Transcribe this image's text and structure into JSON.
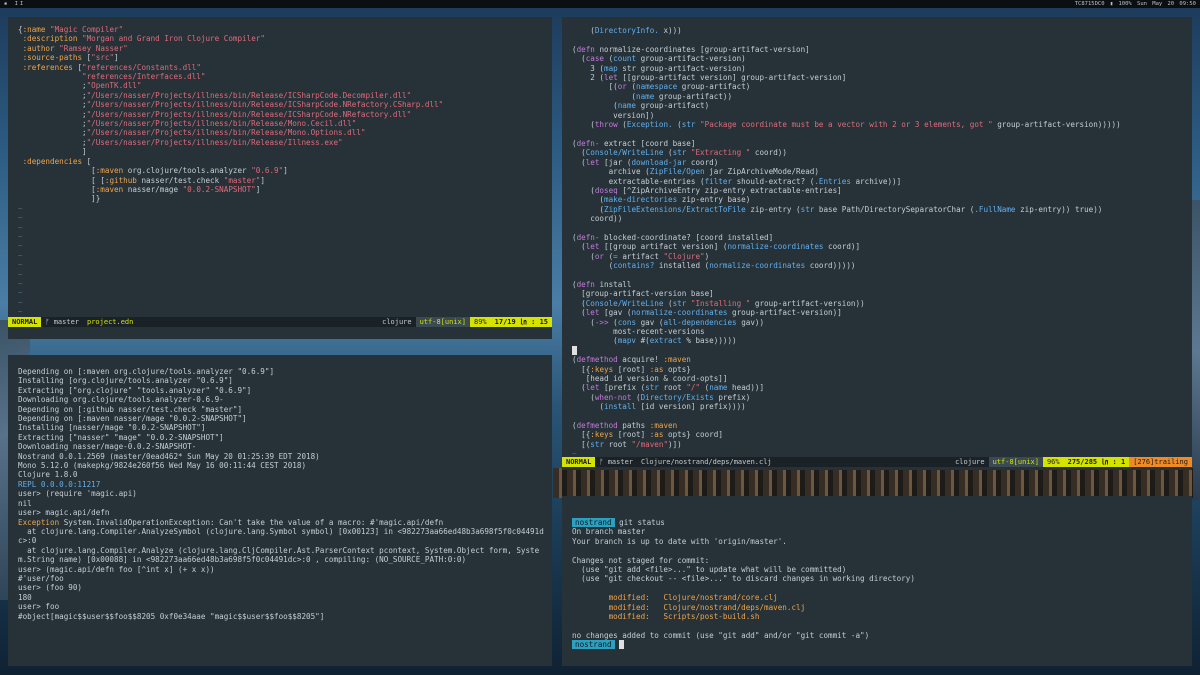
{
  "topbar": {
    "workspaces": "▪ II",
    "tray": "TC8715DC0  ▮ 100%  Sun May 20 09:50"
  },
  "vim_left": {
    "lines": [
      "{:name \"Magic Compiler\"",
      " :description \"Morgan and Grand Iron Clojure Compiler\"",
      " :author \"Ramsey Nasser\"",
      " :source-paths [\"src\"]",
      " :references [\"references/Constants.dll\"",
      "              \"references/Interfaces.dll\"",
      "              ;\"OpenTK.dll\"",
      "              ;\"/Users/nasser/Projects/illness/bin/Release/ICSharpCode.Decompiler.dll\"",
      "              ;\"/Users/nasser/Projects/illness/bin/Release/ICSharpCode.NRefactory.CSharp.dll\"",
      "              ;\"/Users/nasser/Projects/illness/bin/Release/ICSharpCode.NRefactory.dll\"",
      "              ;\"/Users/nasser/Projects/illness/bin/Release/Mono.Cecil.dll\"",
      "              ;\"/Users/nasser/Projects/illness/bin/Release/Mono.Options.dll\"",
      "              ;\"/Users/nasser/Projects/illness/bin/Release/Illness.exe\"",
      "              ]",
      " :dependencies [",
      "                [:maven org.clojure/tools.analyzer \"0.6.9\"]",
      "                [ [:github nasser/test.check \"master\"]",
      "                [:maven nasser/mage \"0.0.2-SNAPSHOT\"]",
      "                ]}"
    ],
    "tildes": 12,
    "status": {
      "mode": "NORMAL",
      "branch": "ᚠ master",
      "file": "project.edn",
      "filetype": "clojure",
      "encoding": "utf-8[unix]",
      "percent": "89%",
      "position": "17/19 ㏑ : 15"
    }
  },
  "repl": {
    "lines": [
      "Depending on [:maven org.clojure/tools.analyzer \"0.6.9\"]",
      "Installing [org.clojure/tools.analyzer \"0.6.9\"]",
      "Extracting [\"org.clojure\" \"tools.analyzer\" \"0.6.9\"]",
      "Downloading org.clojure/tools.analyzer-0.6.9-",
      "Depending on [:github nasser/test.check \"master\"]",
      "Depending on [:maven nasser/mage \"0.0.2-SNAPSHOT\"]",
      "Installing [nasser/mage \"0.0.2-SNAPSHOT\"]",
      "Extracting [\"nasser\" \"mage\" \"0.0.2-SNAPSHOT\"]",
      "Downloading nasser/mage-0.0.2-SNAPSHOT-",
      "Nostrand 0.0.1.2569 (master/0ead462* Sun May 20 01:25:39 EDT 2018)",
      "Mono 5.12.0 (makepkg/9824e260f56 Wed May 16 00:11:44 CEST 2018)",
      "Clojure 1.8.0",
      "REPL 0.0.0.0:11217",
      "user> (require 'magic.api)",
      "nil",
      "user> magic.api/defn",
      "Exception System.InvalidOperationException: Can't take the value of a macro: #'magic.api/defn",
      "  at clojure.lang.Compiler.AnalyzeSymbol (clojure.lang.Symbol symbol) [0x00123] in <982273aa66ed48b3a698f5f0c04491dc>:0",
      "  at clojure.lang.Compiler.Analyze (clojure.lang.CljCompiler.Ast.ParserContext pcontext, System.Object form, System.String name) [0x00088] in <982273aa66ed48b3a698f5f0c04491dc>:0 , compiling: (NO_SOURCE_PATH:0:0)",
      "user> (magic.api/defn foo [^int x] (+ x x))",
      "#'user/foo",
      "user> (foo 90)",
      "180",
      "user> foo",
      "#object[magic$$user$$foo$$8205 0xf0e34aae \"magic$$user$$foo$$8205\"]"
    ]
  },
  "vim_right": {
    "lines": [
      "    (DirectoryInfo. x)))",
      "",
      "(defn normalize-coordinates [group-artifact-version]",
      "  (case (count group-artifact-version)",
      "    3 (map str group-artifact-version)",
      "    2 (let [[group-artifact version] group-artifact-version]",
      "        [(or (namespace group-artifact)",
      "             (name group-artifact))",
      "         (name group-artifact)",
      "         version])",
      "    (throw (Exception. (str \"Package coordinate must be a vector with 2 or 3 elements, got \" group-artifact-version)))))",
      "",
      "(defn- extract [coord base]",
      "  (Console/WriteLine (str \"Extracting \" coord))",
      "  (let [jar (download-jar coord)",
      "        archive (ZipFile/Open jar ZipArchiveMode/Read)",
      "        extractable-entries (filter should-extract? (.Entries archive))]",
      "    (doseq [^ZipArchiveEntry zip-entry extractable-entries]",
      "      (make-directories zip-entry base)",
      "      (ZipFileExtensions/ExtractToFile zip-entry (str base Path/DirectorySeparatorChar (.FullName zip-entry)) true))",
      "    coord))",
      "",
      "(defn- blocked-coordinate? [coord installed]",
      "  (let [[group artifact version] (normalize-coordinates coord)]",
      "    (or (= artifact \"Clojure\")",
      "        (contains? installed (normalize-coordinates coord)))))",
      "",
      "(defn install",
      "  [group-artifact-version base]",
      "  (Console/WriteLine (str \"Installing \" group-artifact-version))",
      "  (let [gav (normalize-coordinates group-artifact-version)]",
      "    (->> (cons gav (all-dependencies gav))",
      "         most-recent-versions",
      "         (mapv #(extract % base)))))",
      " ",
      "(defmethod acquire! :maven",
      "  [{:keys [root] :as opts}",
      "   [head id version & coord-opts]]",
      "  (let [prefix (str root \"/\" (name head))]",
      "    (when-not (Directory/Exists prefix)",
      "      (install [id version] prefix))))",
      "",
      "(defmethod paths :maven",
      "  [{:keys [root] :as opts} coord]",
      "  [(str root \"/maven\")])",
      "~"
    ],
    "status": {
      "mode": "NORMAL",
      "branch": "ᚠ master",
      "file": "Clojure/nostrand/deps/maven.clj",
      "filetype": "clojure",
      "encoding": "utf-8[unix]",
      "percent": "96%",
      "position": "275/285 ㏑ : 1",
      "trailing": "[276]trailing"
    }
  },
  "git": {
    "prompt": "nostrand",
    "command": "git status",
    "lines": [
      "On branch master",
      "Your branch is up to date with 'origin/master'.",
      "",
      "Changes not staged for commit:",
      "  (use \"git add <file>...\" to update what will be committed)",
      "  (use \"git checkout -- <file>...\" to discard changes in working directory)",
      ""
    ],
    "modified": [
      "Clojure/nostrand/core.clj",
      "Clojure/nostrand/deps/maven.clj",
      "Scripts/post-build.sh"
    ],
    "modified_label": "modified:",
    "footer": "no changes added to commit (use \"git add\" and/or \"git commit -a\")",
    "prompt2": "nostrand"
  }
}
